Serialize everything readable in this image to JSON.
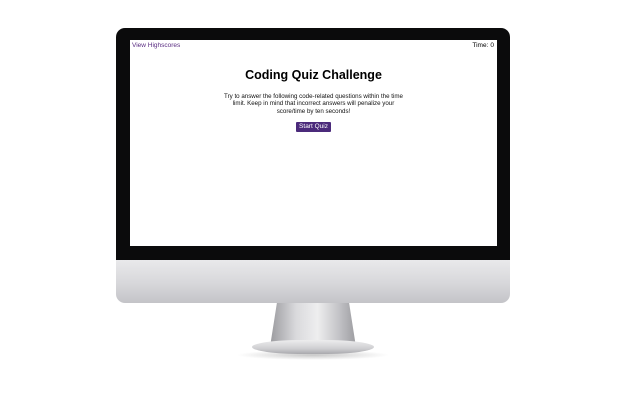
{
  "header": {
    "highscores_label": "View Highscores",
    "timer_label": "Time:",
    "timer_value": "0"
  },
  "main": {
    "title": "Coding Quiz Challenge",
    "description": "Try to answer the following code-related questions within the time limit. Keep in mind that incorrect answers will penalize your score/time by ten seconds!",
    "start_label": "Start Quiz"
  },
  "colors": {
    "accent": "#4b2a7b",
    "link": "#5a2d82"
  }
}
